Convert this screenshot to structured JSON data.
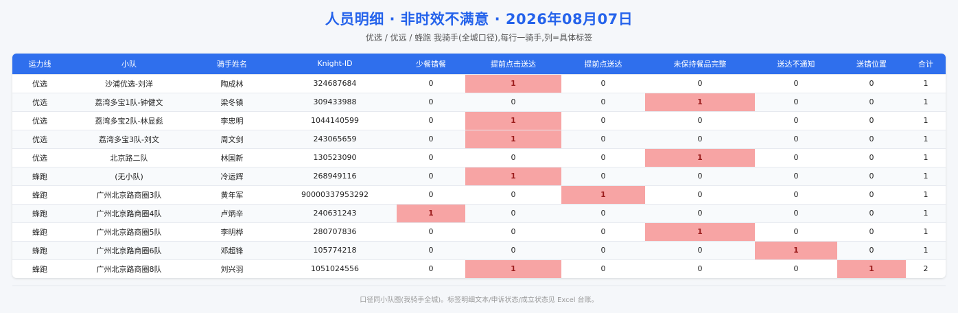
{
  "header": {
    "title": "人员明细 · 非时效不满意 · 2026年08月07日",
    "subtitle": "优选 / 优远 / 蜂跑 我骑手(全城口径),每行一骑手,列=具体标签"
  },
  "table": {
    "columns": [
      "运力线",
      "小队",
      "骑手姓名",
      "Knight-ID",
      "少餐错餐",
      "提前点击送达",
      "提前点送达",
      "未保持餐品完整",
      "送达不通知",
      "送错位置",
      "合计"
    ],
    "rows": [
      [
        "优选",
        "沙浦优选-刘洋",
        "陶成林",
        "324687684",
        "0",
        "1",
        "0",
        "0",
        "0",
        "0",
        "1"
      ],
      [
        "优选",
        "荔湾多宝1队-钟健文",
        "梁冬镇",
        "309433988",
        "0",
        "0",
        "0",
        "1",
        "0",
        "0",
        "1"
      ],
      [
        "优选",
        "荔湾多宝2队-林显彪",
        "李忠明",
        "1044140599",
        "0",
        "1",
        "0",
        "0",
        "0",
        "0",
        "1"
      ],
      [
        "优选",
        "荔湾多宝3队-刘文",
        "周文剑",
        "243065659",
        "0",
        "1",
        "0",
        "0",
        "0",
        "0",
        "1"
      ],
      [
        "优选",
        "北京路二队",
        "林国新",
        "130523090",
        "0",
        "0",
        "0",
        "1",
        "0",
        "0",
        "1"
      ],
      [
        "蜂跑",
        "(无小队)",
        "冷运辉",
        "268949116",
        "0",
        "1",
        "0",
        "0",
        "0",
        "0",
        "1"
      ],
      [
        "蜂跑",
        "广州北京路商圈3队",
        "黄年军",
        "90000337953292",
        "0",
        "0",
        "1",
        "0",
        "0",
        "0",
        "1"
      ],
      [
        "蜂跑",
        "广州北京路商圈4队",
        "卢炳辛",
        "240631243",
        "1",
        "0",
        "0",
        "0",
        "0",
        "0",
        "1"
      ],
      [
        "蜂跑",
        "广州北京路商圈5队",
        "李明桦",
        "280707836",
        "0",
        "0",
        "0",
        "1",
        "0",
        "0",
        "1"
      ],
      [
        "蜂跑",
        "广州北京路商圈6队",
        "邓超锋",
        "105774218",
        "0",
        "0",
        "0",
        "0",
        "1",
        "0",
        "1"
      ],
      [
        "蜂跑",
        "广州北京路商圈8队",
        "刘兴羽",
        "1051024556",
        "0",
        "1",
        "0",
        "0",
        "0",
        "1",
        "2"
      ]
    ]
  },
  "footer": {
    "note": "口径同小队图(我骑手全城)。标签明细文本/申诉状态/成立状态见 Excel 台账。"
  },
  "colors": {
    "accent": "#2563eb",
    "header_bg": "#2f6fed",
    "highlight": "#f7a4a4"
  }
}
